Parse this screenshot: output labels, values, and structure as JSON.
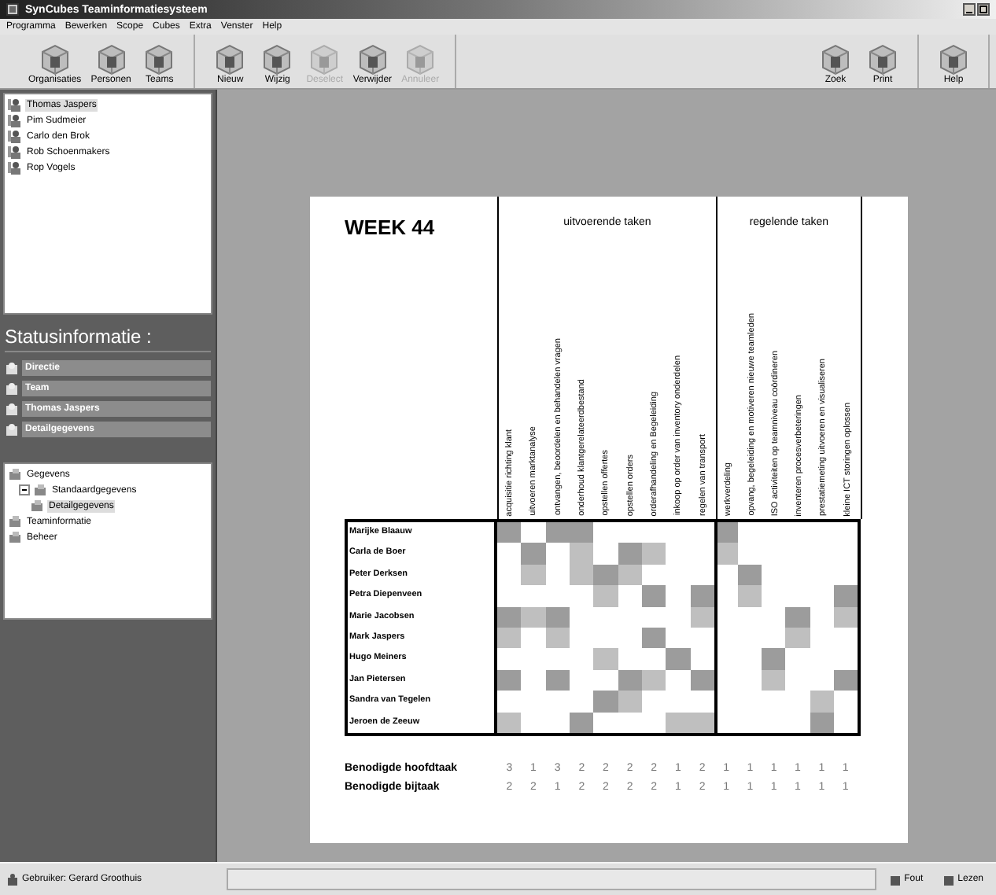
{
  "window": {
    "title": "SynCubes Teaminformatiesysteem"
  },
  "menu": [
    "Programma",
    "Bewerken",
    "Scope",
    "Cubes",
    "Extra",
    "Venster",
    "Help"
  ],
  "toolbar": {
    "left": [
      [
        {
          "label": "Organisaties",
          "disabled": false
        },
        {
          "label": "Personen",
          "disabled": false
        },
        {
          "label": "Teams",
          "disabled": false
        }
      ],
      [
        {
          "label": "Nieuw",
          "disabled": false
        },
        {
          "label": "Wijzig",
          "disabled": false
        },
        {
          "label": "Deselect",
          "disabled": true
        },
        {
          "label": "Verwijder",
          "disabled": false
        },
        {
          "label": "Annuleer",
          "disabled": true
        }
      ]
    ],
    "right": [
      [
        {
          "label": "Zoek",
          "disabled": false
        },
        {
          "label": "Print",
          "disabled": false
        }
      ],
      [
        {
          "label": "Help",
          "disabled": false
        }
      ]
    ]
  },
  "people": [
    {
      "name": "Thomas Jaspers",
      "selected": true
    },
    {
      "name": "Pim Sudmeier",
      "selected": false
    },
    {
      "name": "Carlo den Brok",
      "selected": false
    },
    {
      "name": "Rob Schoenmakers",
      "selected": false
    },
    {
      "name": "Rop Vogels",
      "selected": false
    }
  ],
  "status_panel": {
    "title": "Statusinformatie :",
    "items": [
      "Directie",
      "Team",
      "Thomas Jaspers",
      "Detailgegevens"
    ]
  },
  "tree": [
    {
      "label": "Gegevens",
      "selected": false,
      "children": [
        {
          "label": "Standaardgegevens",
          "selected": false,
          "expanded": true,
          "children": [
            {
              "label": "Detailgegevens",
              "selected": true
            }
          ]
        }
      ]
    },
    {
      "label": "Teaminformatie",
      "selected": false
    },
    {
      "label": "Beheer",
      "selected": false
    }
  ],
  "report": {
    "title": "WEEK 44",
    "groups": [
      {
        "title": "uitvoerende taken",
        "tasks": [
          "acquisitie richting klant",
          "uitvoeren marktanalyse",
          "ontvangen, beoordelen en behandelen vragen",
          "onderhoud klantgerelateerdbestand",
          "opstellen offertes",
          "opstellen orders",
          "orderafhandeling en Begeleiding",
          "inkoop op order van inventory onderdelen",
          "regelen van transport"
        ]
      },
      {
        "title": "regelende taken",
        "tasks": [
          "werkverdeling",
          "opvang, begeleiding en motiveren nieuwe teamleden",
          "ISO activiteiten op teamniveau coördineren",
          "inventeren procesverbeteringen",
          "prestatiemeting uitvoeren en visualiseren",
          "kleine ICT storingen oplossen"
        ]
      }
    ],
    "rows": [
      {
        "name": "Marijke Blaauw",
        "cells": [
          {
            "kind": "dark"
          },
          {
            "kind": "empty"
          },
          {
            "kind": "dark"
          },
          {
            "kind": "dark"
          },
          {
            "kind": "empty"
          },
          {
            "kind": "empty"
          },
          {
            "kind": "empty"
          },
          {
            "kind": "empty"
          },
          {
            "kind": "empty"
          },
          {
            "kind": "dark"
          },
          {
            "kind": "empty"
          },
          {
            "kind": "empty"
          },
          {
            "kind": "empty"
          },
          {
            "kind": "empty"
          },
          {
            "kind": "empty"
          }
        ]
      },
      {
        "name": "Carla de Boer",
        "cells": [
          {
            "kind": "empty"
          },
          {
            "kind": "dark"
          },
          {
            "kind": "empty"
          },
          {
            "kind": "light"
          },
          {
            "kind": "empty"
          },
          {
            "kind": "dark"
          },
          {
            "kind": "light"
          },
          {
            "kind": "empty"
          },
          {
            "kind": "empty"
          },
          {
            "kind": "light"
          },
          {
            "kind": "empty"
          },
          {
            "kind": "empty"
          },
          {
            "kind": "empty"
          },
          {
            "kind": "empty"
          },
          {
            "kind": "empty"
          }
        ]
      },
      {
        "name": "Peter Derksen",
        "cells": [
          {
            "kind": "empty"
          },
          {
            "kind": "light"
          },
          {
            "kind": "empty"
          },
          {
            "kind": "light"
          },
          {
            "kind": "dark"
          },
          {
            "kind": "light"
          },
          {
            "kind": "empty"
          },
          {
            "kind": "empty"
          },
          {
            "kind": "empty"
          },
          {
            "kind": "empty"
          },
          {
            "kind": "dark"
          },
          {
            "kind": "empty"
          },
          {
            "kind": "empty"
          },
          {
            "kind": "empty"
          },
          {
            "kind": "empty"
          }
        ]
      },
      {
        "name": "Petra Diepenveen",
        "cells": [
          {
            "kind": "empty"
          },
          {
            "kind": "empty"
          },
          {
            "kind": "empty"
          },
          {
            "kind": "empty"
          },
          {
            "kind": "light"
          },
          {
            "kind": "empty"
          },
          {
            "kind": "dark"
          },
          {
            "kind": "empty"
          },
          {
            "kind": "dark"
          },
          {
            "kind": "empty"
          },
          {
            "kind": "light"
          },
          {
            "kind": "empty"
          },
          {
            "kind": "empty"
          },
          {
            "kind": "empty"
          },
          {
            "kind": "dark"
          }
        ]
      },
      {
        "name": "Marie Jacobsen",
        "cells": [
          {
            "kind": "dark"
          },
          {
            "kind": "light"
          },
          {
            "kind": "dark"
          },
          {
            "kind": "empty"
          },
          {
            "kind": "empty"
          },
          {
            "kind": "empty"
          },
          {
            "kind": "empty"
          },
          {
            "kind": "empty"
          },
          {
            "kind": "light"
          },
          {
            "kind": "empty"
          },
          {
            "kind": "empty"
          },
          {
            "kind": "empty"
          },
          {
            "kind": "dark"
          },
          {
            "kind": "empty"
          },
          {
            "kind": "light"
          }
        ]
      },
      {
        "name": "Mark Jaspers",
        "cells": [
          {
            "kind": "light"
          },
          {
            "kind": "empty"
          },
          {
            "kind": "light"
          },
          {
            "kind": "empty"
          },
          {
            "kind": "empty"
          },
          {
            "kind": "empty"
          },
          {
            "kind": "dark"
          },
          {
            "kind": "empty"
          },
          {
            "kind": "empty"
          },
          {
            "kind": "empty"
          },
          {
            "kind": "empty"
          },
          {
            "kind": "empty"
          },
          {
            "kind": "light"
          },
          {
            "kind": "empty"
          },
          {
            "kind": "empty"
          }
        ]
      },
      {
        "name": "Hugo Meiners",
        "cells": [
          {
            "kind": "empty"
          },
          {
            "kind": "empty"
          },
          {
            "kind": "empty"
          },
          {
            "kind": "empty"
          },
          {
            "kind": "light"
          },
          {
            "kind": "empty"
          },
          {
            "kind": "empty"
          },
          {
            "kind": "dark"
          },
          {
            "kind": "empty"
          },
          {
            "kind": "empty"
          },
          {
            "kind": "empty"
          },
          {
            "kind": "dark"
          },
          {
            "kind": "empty"
          },
          {
            "kind": "empty"
          },
          {
            "kind": "empty"
          }
        ]
      },
      {
        "name": "Jan Pietersen",
        "cells": [
          {
            "kind": "dark"
          },
          {
            "kind": "empty"
          },
          {
            "kind": "dark"
          },
          {
            "kind": "empty"
          },
          {
            "kind": "empty"
          },
          {
            "kind": "dark"
          },
          {
            "kind": "light"
          },
          {
            "kind": "empty"
          },
          {
            "kind": "dark"
          },
          {
            "kind": "empty"
          },
          {
            "kind": "empty"
          },
          {
            "kind": "light"
          },
          {
            "kind": "empty"
          },
          {
            "kind": "empty"
          },
          {
            "kind": "dark"
          }
        ]
      },
      {
        "name": "Sandra van Tegelen",
        "cells": [
          {
            "kind": "empty"
          },
          {
            "kind": "empty"
          },
          {
            "kind": "empty"
          },
          {
            "kind": "empty"
          },
          {
            "kind": "dark"
          },
          {
            "kind": "light"
          },
          {
            "kind": "empty"
          },
          {
            "kind": "empty"
          },
          {
            "kind": "empty"
          },
          {
            "kind": "empty"
          },
          {
            "kind": "empty"
          },
          {
            "kind": "empty"
          },
          {
            "kind": "empty"
          },
          {
            "kind": "light"
          },
          {
            "kind": "empty"
          }
        ]
      },
      {
        "name": "Jeroen de Zeeuw",
        "cells": [
          {
            "kind": "light"
          },
          {
            "kind": "empty"
          },
          {
            "kind": "empty"
          },
          {
            "kind": "dark"
          },
          {
            "kind": "empty"
          },
          {
            "kind": "empty"
          },
          {
            "kind": "empty"
          },
          {
            "kind": "light"
          },
          {
            "kind": "light"
          },
          {
            "kind": "empty"
          },
          {
            "kind": "empty"
          },
          {
            "kind": "empty"
          },
          {
            "kind": "empty"
          },
          {
            "kind": "dark"
          },
          {
            "kind": "empty"
          }
        ]
      }
    ],
    "totals": [
      {
        "label": "Benodigde hoofdtaak",
        "values": [
          "3",
          "1",
          "3",
          "2",
          "2",
          "2",
          "2",
          "1",
          "2",
          "1",
          "1",
          "1",
          "1",
          "1",
          "1"
        ]
      },
      {
        "label": "Benodigde bijtaak",
        "values": [
          "2",
          "2",
          "1",
          "2",
          "2",
          "2",
          "2",
          "1",
          "2",
          "1",
          "1",
          "1",
          "1",
          "1",
          "1"
        ]
      }
    ]
  },
  "status_bar": {
    "user": "Gebruiker: Gerard Groothuis",
    "indicators": [
      "Fout",
      "Lezen"
    ]
  }
}
